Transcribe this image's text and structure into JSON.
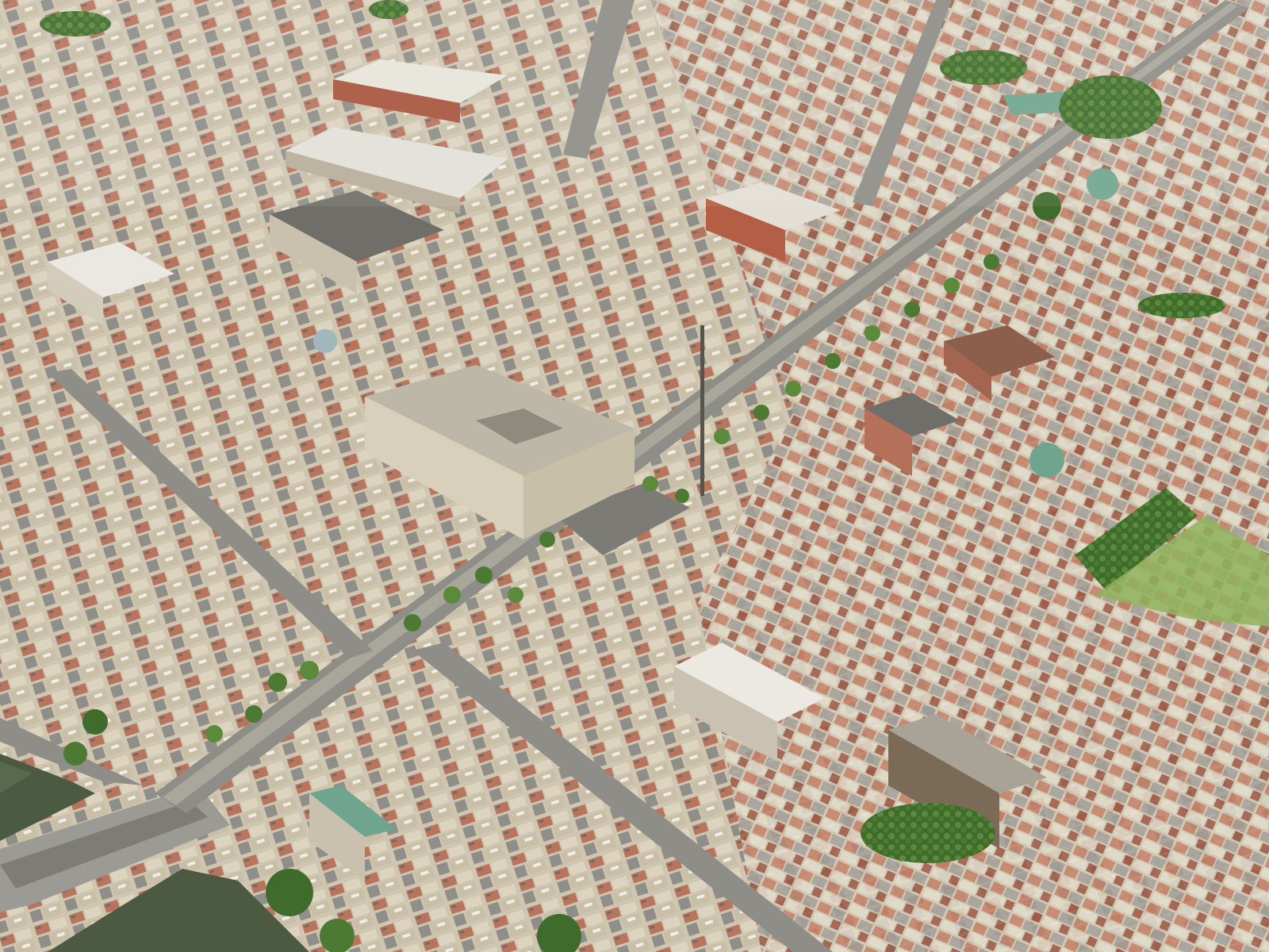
{
  "map": {
    "view": "3d-aerial",
    "palette": {
      "ground": "#cfc8b6",
      "road": "#8e8d87",
      "road_light": "#a9a69c",
      "river": "#4d5a42",
      "river_light": "#5b6a4f",
      "tree": "#3f6b2c",
      "tree_light": "#5b8a3a",
      "brick": "#b5705a",
      "brick_dark": "#8f4f3f",
      "stone": "#d9d0bb",
      "stone_dark": "#b7ad98",
      "roof_grey": "#7b7a75",
      "roof_light": "#e3e0d8",
      "copper": "#6fa58f",
      "grass": "#8fb35c"
    }
  }
}
